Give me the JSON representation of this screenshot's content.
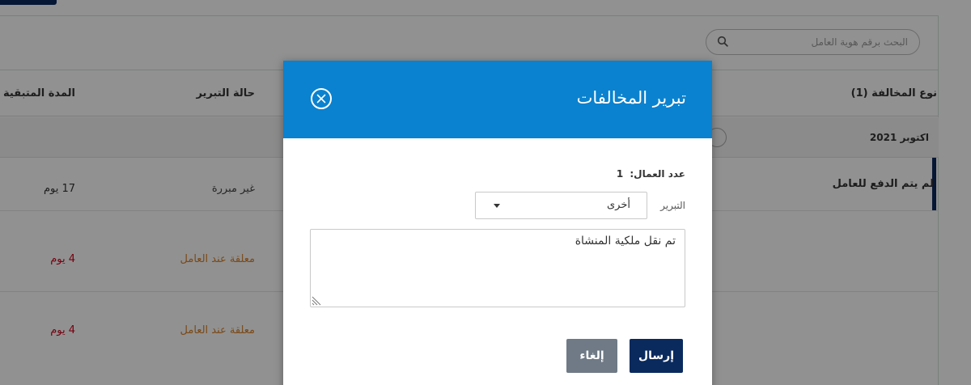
{
  "search": {
    "placeholder": "البحث برقم هوية العامل"
  },
  "table": {
    "headers": {
      "violation_type": "نوع المخالفة (1)",
      "justification_status": "حالة التبرير",
      "remaining_period": "المدة المتبقية"
    },
    "month_group": "اكتوبر 2021",
    "rows": [
      {
        "violation": "لم يتم الدفع للعامل",
        "status": "غير مبررة",
        "days": "17 يوم",
        "status_color": "#444444",
        "days_color": "#333333"
      },
      {
        "violation": "",
        "status": "معلقة عند العامل",
        "days": "4 يوم",
        "status_color": "#d9822b",
        "days_color": "#d0021b"
      },
      {
        "violation": "",
        "status": "معلقة عند العامل",
        "days": "4 يوم",
        "status_color": "#d9822b",
        "days_color": "#d0021b"
      }
    ]
  },
  "modal": {
    "title": "تبرير المخالفات",
    "worker_count_label": "عدد العمال:",
    "worker_count_value": "1",
    "justification_label": "التبرير",
    "justification_selected": "أخرى",
    "textarea_value": "تم نقل ملكية المنشاة",
    "send_label": "إرسال",
    "cancel_label": "إلغاء",
    "header_color": "#0a82cf",
    "send_color": "#0a2a5e",
    "cancel_color": "#6f7a86",
    "close_icon": "close-circle-icon"
  }
}
